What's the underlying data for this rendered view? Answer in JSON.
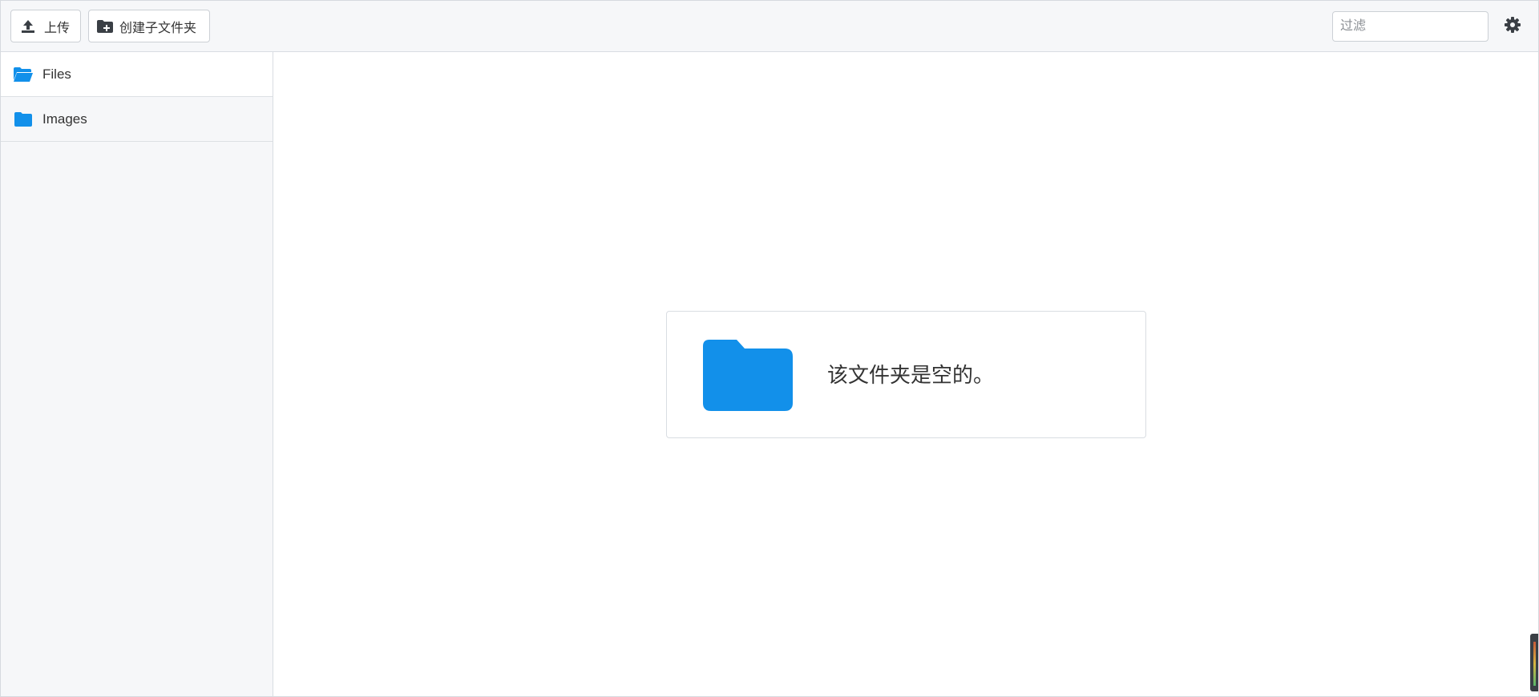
{
  "toolbar": {
    "upload_label": "上传",
    "new_folder_label": "创建子文件夹",
    "filter_placeholder": "过滤",
    "filter_value": ""
  },
  "sidebar": {
    "items": [
      {
        "label": "Files",
        "icon": "folder-open-icon",
        "active": true
      },
      {
        "label": "Images",
        "icon": "folder-icon",
        "active": false
      }
    ]
  },
  "main": {
    "empty_message": "该文件夹是空的。",
    "empty_icon": "folder-icon"
  },
  "colors": {
    "accent": "#1290EA",
    "toolbar_bg": "#F6F7F9",
    "icon_dark": "#3A3F45"
  }
}
